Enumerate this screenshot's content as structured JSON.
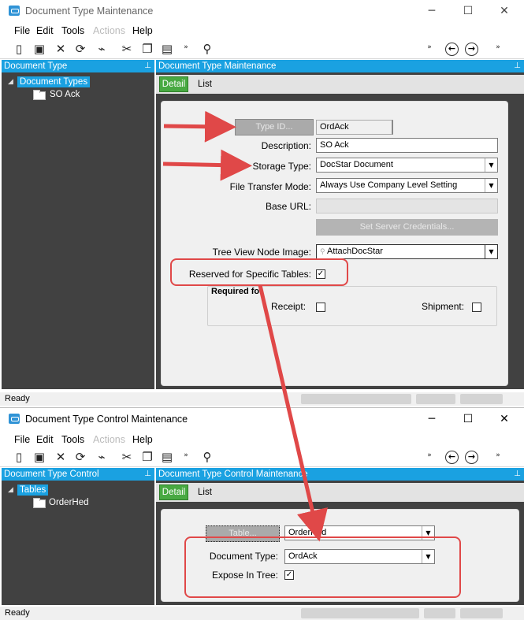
{
  "window1": {
    "title": "Document Type Maintenance",
    "menu": [
      "File",
      "Edit",
      "Tools",
      "Actions",
      "Help"
    ],
    "left_pane_title": "Document Type",
    "tree_root": "Document Types",
    "tree_child": "SO Ack",
    "right_pane_title": "Document Type Maintenance",
    "tab_detail": "Detail",
    "tab_list": "List",
    "type_id_button": "Type ID...",
    "type_id_value": "OrdAck",
    "description_label": "Description:",
    "description_value": "SO Ack",
    "storage_type_label": "Storage Type:",
    "storage_type_value": "DocStar Document",
    "file_transfer_label": "File Transfer Mode:",
    "file_transfer_value": "Always Use Company Level Setting",
    "base_url_label": "Base URL:",
    "base_url_value": "",
    "set_credentials_button": "Set Server Credentials...",
    "tree_view_label": "Tree View Node Image:",
    "tree_view_value": "AttachDocStar",
    "reserved_label": "Reserved for Specific Tables:",
    "reserved_checked": true,
    "required_for_label": "Required fo",
    "receipt_label": "Receipt:",
    "shipment_label": "Shipment:",
    "status": "Ready"
  },
  "window2": {
    "title": "Document Type Control Maintenance",
    "menu": [
      "File",
      "Edit",
      "Tools",
      "Actions",
      "Help"
    ],
    "left_pane_title": "Document Type Control",
    "tree_root": "Tables",
    "tree_child": "OrderHed",
    "right_pane_title": "Document Type Control Maintenance",
    "tab_detail": "Detail",
    "tab_list": "List",
    "table_button": "Table...",
    "table_value": "OrderHed",
    "document_type_label": "Document Type:",
    "document_type_value": "OrdAck",
    "expose_label": "Expose In Tree:",
    "expose_checked": true,
    "status": "Ready"
  },
  "colors": {
    "accent_blue": "#1aa1e1",
    "tab_green": "#48a942",
    "annotation_red": "#e04848",
    "pane_dark": "#414141"
  },
  "icons": {
    "window_controls": [
      "minimize-icon",
      "maximize-icon",
      "close-icon"
    ],
    "toolbar": [
      "new-icon",
      "save-icon",
      "delete-icon",
      "refresh-icon",
      "clear-icon",
      "cut-icon",
      "copy-icon",
      "paste-icon",
      "binoculars-icon",
      "back-icon",
      "forward-icon"
    ]
  }
}
